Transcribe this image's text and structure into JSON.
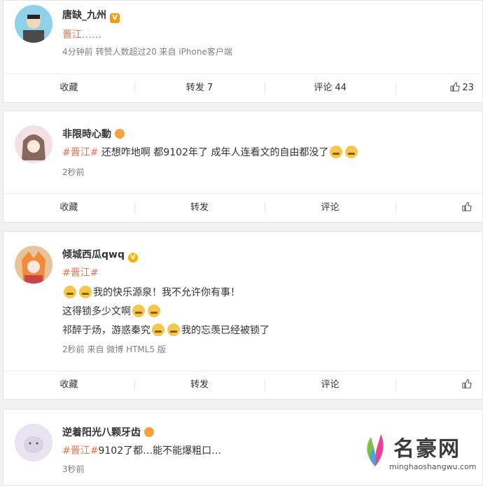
{
  "posts": [
    {
      "user": "唐缺_九州",
      "lines": [
        [
          {
            "t": "晋江……",
            "topic": true
          }
        ]
      ],
      "meta": "4分钟前  转赞人数超过20  来自 iPhone客户端",
      "actions": {
        "collect": "收藏",
        "repost": "转发 7",
        "comment": "评论 44",
        "like": "23"
      },
      "badge": "V"
    },
    {
      "user": "非限時心動",
      "lines": [
        [
          {
            "t": "#晋江#",
            "topic": true
          },
          {
            "t": " 还想咋地啊 都9102年了 成年人连看文的自由都没了"
          }
        ]
      ],
      "meta": "2秒前",
      "actions": {
        "collect": "收藏",
        "repost": "转发",
        "comment": "评论",
        "like": ""
      }
    },
    {
      "user": "倾城西瓜qwq",
      "lines": [
        [
          {
            "t": "#晋江#",
            "topic": true
          }
        ],
        [
          {
            "t": "我的快乐源泉！我不允许你有事！"
          }
        ],
        [
          {
            "t": "这得锁多少文啊"
          }
        ],
        [
          {
            "t": "祁醉于炀，游惑秦究"
          },
          {
            "t": "我的忘羡已经被锁了"
          }
        ]
      ],
      "meta": "2秒前  来自 微博 HTML5 版",
      "actions": {
        "collect": "收藏",
        "repost": "转发",
        "comment": "评论",
        "like": ""
      }
    },
    {
      "user": "逆着阳光八颗牙齿",
      "lines": [
        [
          {
            "t": "#晋江#",
            "topic": true
          },
          {
            "t": "9102了都…能不能爆粗口…"
          }
        ]
      ],
      "meta": "3秒前"
    }
  ],
  "watermark": {
    "brand": "名豪网",
    "url": "minghaoshangwu.com"
  }
}
